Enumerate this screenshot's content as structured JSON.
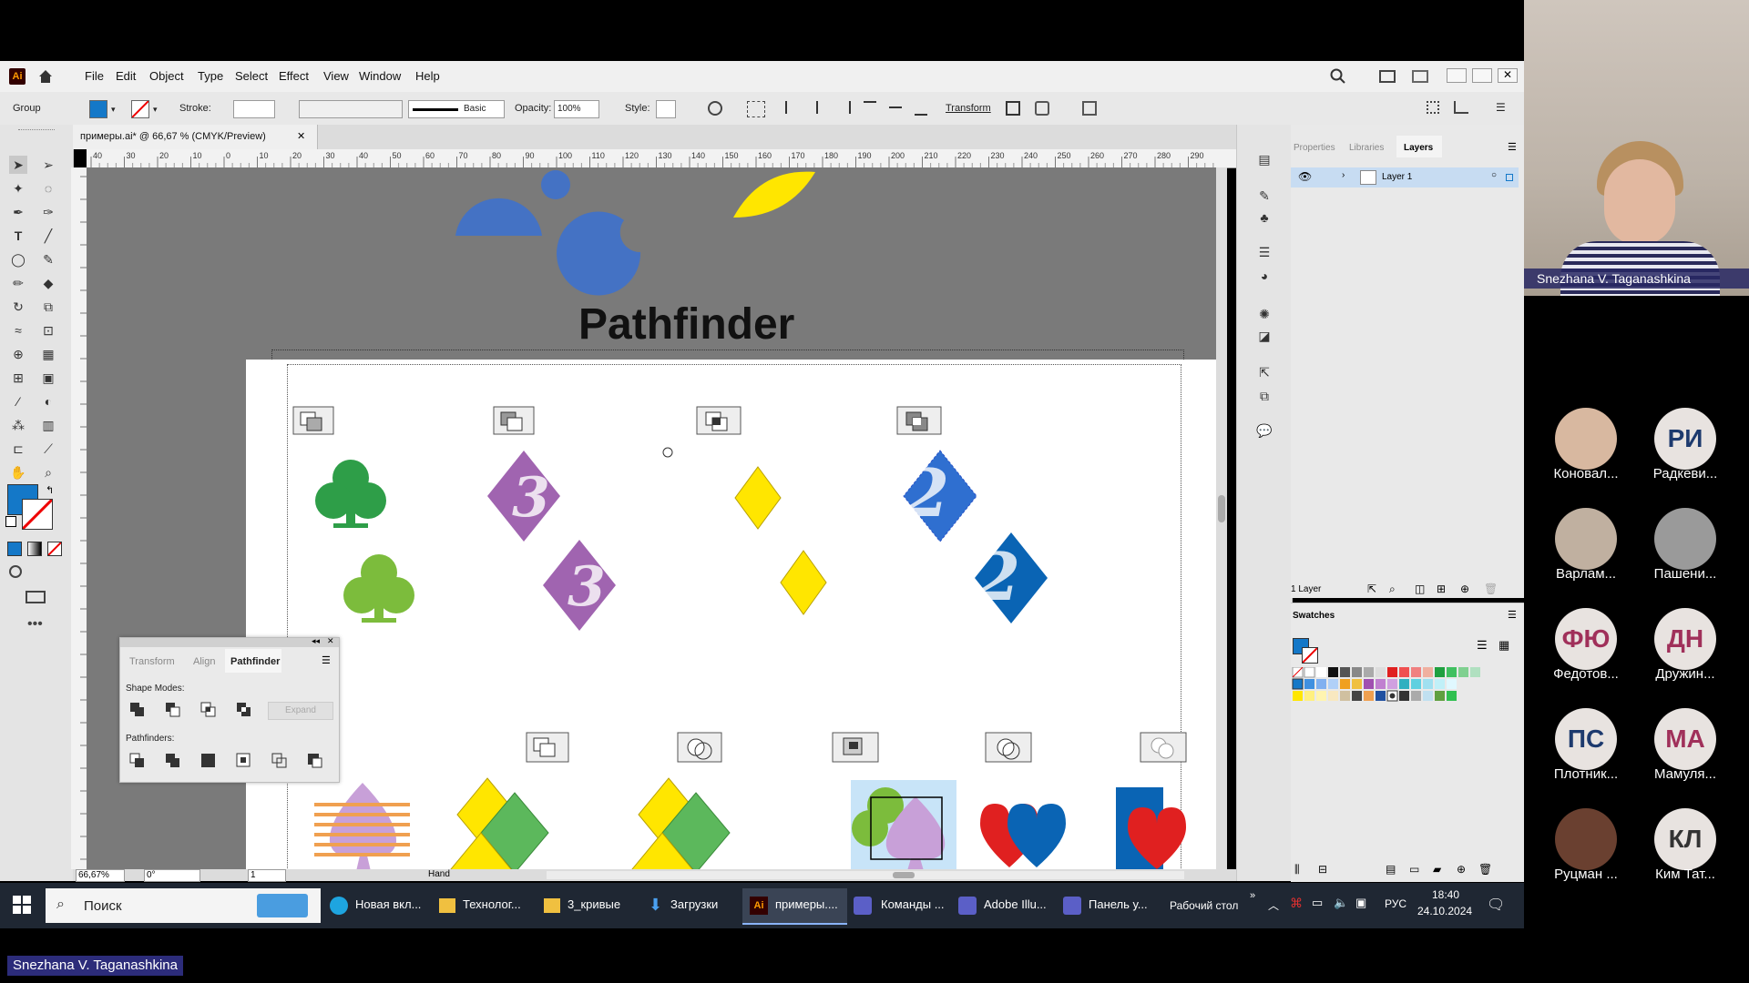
{
  "app": {
    "name": "Adobe Illustrator",
    "logo": "Ai"
  },
  "menu": [
    "File",
    "Edit",
    "Object",
    "Type",
    "Select",
    "Effect",
    "View",
    "Window",
    "Help"
  ],
  "control": {
    "selection": "Group",
    "stroke_label": "Stroke:",
    "profile": "Basic",
    "opacity_label": "Opacity:",
    "opacity_value": "100%",
    "style_label": "Style:",
    "transform_label": "Transform"
  },
  "document": {
    "tab_title": "примеры.ai* @ 66,67 % (CMYK/Preview)"
  },
  "ruler_ticks": [
    "40",
    "30",
    "20",
    "10",
    "0",
    "10",
    "20",
    "30",
    "40",
    "50",
    "60",
    "70",
    "80",
    "90",
    "100",
    "110",
    "120",
    "130",
    "140",
    "150",
    "160",
    "170",
    "180",
    "190",
    "200",
    "210",
    "220",
    "230",
    "240",
    "250",
    "260",
    "270",
    "280",
    "290"
  ],
  "canvas": {
    "title": "Pathfinder"
  },
  "pathfinder_panel": {
    "tabs": [
      "Transform",
      "Align",
      "Pathfinder"
    ],
    "active_tab": "Pathfinder",
    "shape_modes_label": "Shape Modes:",
    "expand_label": "Expand",
    "pathfinders_label": "Pathfinders:"
  },
  "status": {
    "zoom": "66,67%",
    "rotation": "0°",
    "artboard": "1",
    "tool": "Hand"
  },
  "layers_panel": {
    "tabs": [
      "Properties",
      "Libraries",
      "Layers"
    ],
    "active_tab": "Layers",
    "layer_name": "Layer 1",
    "count": "1 Layer"
  },
  "swatches_panel": {
    "title": "Swatches"
  },
  "taskbar": {
    "search": "Поиск",
    "items": [
      "Новая вкл...",
      "Технолог...",
      "3_кривые",
      "Загрузки",
      "примеры....",
      "Команды ...",
      "Adobe Illu...",
      "Панель у..."
    ],
    "desktop": "Рабочий стол",
    "lang": "РУС",
    "time": "18:40",
    "date": "24.10.2024"
  },
  "presenter": {
    "name": "Snezhana V. Taganashkina"
  },
  "participants": [
    {
      "initials": "",
      "name": "Коновал..."
    },
    {
      "initials": "РИ",
      "name": "Радкеви..."
    },
    {
      "initials": "",
      "name": "Варлам..."
    },
    {
      "initials": "",
      "name": "Пашени..."
    },
    {
      "initials": "ФЮ",
      "name": "Федотов..."
    },
    {
      "initials": "ДН",
      "name": "Дружин..."
    },
    {
      "initials": "ПС",
      "name": "Плотник..."
    },
    {
      "initials": "МА",
      "name": "Мамуля..."
    },
    {
      "initials": "",
      "name": "Руцман ..."
    },
    {
      "initials": "КЛ",
      "name": "Ким Тат..."
    }
  ],
  "colors": {
    "yellow": "#ffe600",
    "blue": "#4472c4",
    "purple": "#a064b0",
    "green": "#2e9e48",
    "light_green": "#7cbc3c",
    "mid_green": "#5cb85c",
    "orange": "#f0a050",
    "lilac": "#c8a0d8",
    "red": "#e02020",
    "royal_blue": "#0a64b4",
    "fill_swatch": "#1478c8"
  }
}
